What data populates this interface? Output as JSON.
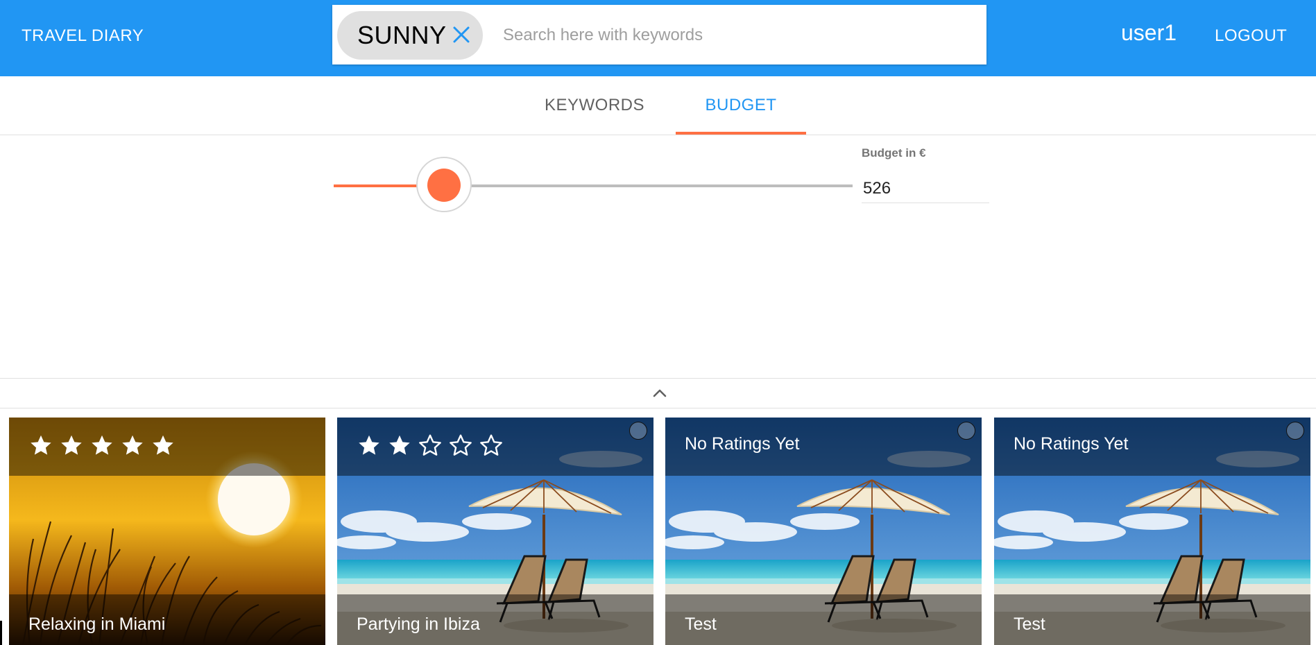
{
  "app": {
    "brand": "TRAVEL DIARY",
    "user": "user1",
    "logout_label": "LOGOUT"
  },
  "search": {
    "chip_label": "SUNNY",
    "placeholder": "Search here with keywords",
    "value": ""
  },
  "tabs": [
    {
      "label": "KEYWORDS",
      "active": false
    },
    {
      "label": "BUDGET",
      "active": true
    }
  ],
  "budget": {
    "label": "Budget in €",
    "value": "526",
    "slider_fraction": 0.212,
    "accent_color": "#ff7043"
  },
  "cards": [
    {
      "title": "Relaxing in Miami",
      "rating": 5,
      "max_rating": 5,
      "rating_text": "",
      "image": "sunset-grass",
      "selected": true
    },
    {
      "title": "Partying in Ibiza",
      "rating": 2,
      "max_rating": 5,
      "rating_text": "",
      "image": "beach-umbrella",
      "selected": false
    },
    {
      "title": "Test",
      "rating": 0,
      "max_rating": 5,
      "rating_text": "No Ratings Yet",
      "image": "beach-umbrella",
      "selected": false
    },
    {
      "title": "Test",
      "rating": 0,
      "max_rating": 5,
      "rating_text": "No Ratings Yet",
      "image": "beach-umbrella",
      "selected": false
    }
  ],
  "colors": {
    "appbar": "#2196f3",
    "tab_active": "#2196f3",
    "tab_indicator": "#ff7043"
  }
}
